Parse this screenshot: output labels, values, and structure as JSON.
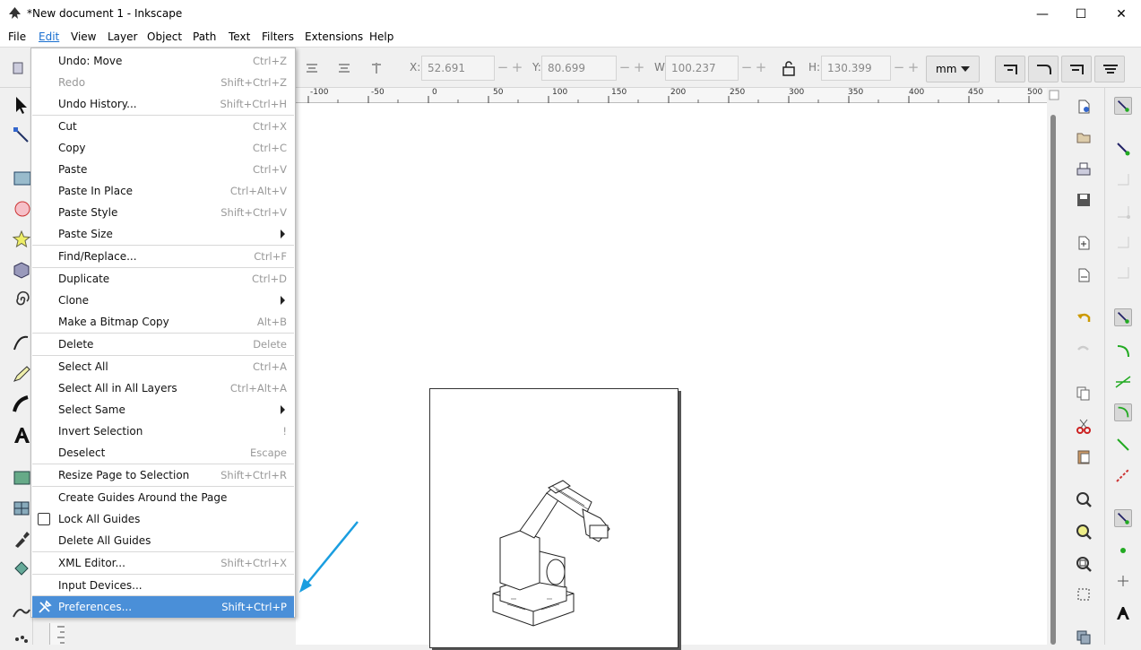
{
  "window": {
    "title": "*New document 1 - Inkscape",
    "minimize": "—",
    "maximize": "☐",
    "close": "✕"
  },
  "menubar": [
    "File",
    "Edit",
    "View",
    "Layer",
    "Object",
    "Path",
    "Text",
    "Filters",
    "Extensions",
    "Help"
  ],
  "toolbar": {
    "x_label": "X:",
    "x_value": "52.691",
    "y_label": "Y:",
    "y_value": "80.699",
    "w_label": "W:",
    "w_value": "100.237",
    "h_label": "H:",
    "h_value": "130.399",
    "minus": "−",
    "plus": "+",
    "unit": "mm"
  },
  "ruler": [
    "-100",
    "-50",
    "0",
    "50",
    "100",
    "150",
    "200",
    "250",
    "300",
    "350",
    "400",
    "450",
    "500"
  ],
  "edit_menu": {
    "undo": {
      "label": "Undo: Move",
      "shortcut": "Ctrl+Z"
    },
    "redo": {
      "label": "Redo",
      "shortcut": "Shift+Ctrl+Z"
    },
    "undo_history": {
      "label": "Undo History...",
      "shortcut": "Shift+Ctrl+H"
    },
    "cut": {
      "label": "Cut",
      "shortcut": "Ctrl+X"
    },
    "copy": {
      "label": "Copy",
      "shortcut": "Ctrl+C"
    },
    "paste": {
      "label": "Paste",
      "shortcut": "Ctrl+V"
    },
    "paste_in_place": {
      "label": "Paste In Place",
      "shortcut": "Ctrl+Alt+V"
    },
    "paste_style": {
      "label": "Paste Style",
      "shortcut": "Shift+Ctrl+V"
    },
    "paste_size": {
      "label": "Paste Size"
    },
    "find_replace": {
      "label": "Find/Replace...",
      "shortcut": "Ctrl+F"
    },
    "duplicate": {
      "label": "Duplicate",
      "shortcut": "Ctrl+D"
    },
    "clone": {
      "label": "Clone"
    },
    "bitmap_copy": {
      "label": "Make a Bitmap Copy",
      "shortcut": "Alt+B"
    },
    "delete": {
      "label": "Delete",
      "shortcut": "Delete"
    },
    "select_all": {
      "label": "Select All",
      "shortcut": "Ctrl+A"
    },
    "select_all_layers": {
      "label": "Select All in All Layers",
      "shortcut": "Ctrl+Alt+A"
    },
    "select_same": {
      "label": "Select Same"
    },
    "invert_selection": {
      "label": "Invert Selection",
      "shortcut": "!"
    },
    "deselect": {
      "label": "Deselect",
      "shortcut": "Escape"
    },
    "resize_page": {
      "label": "Resize Page to Selection",
      "shortcut": "Shift+Ctrl+R"
    },
    "create_guides": {
      "label": "Create Guides Around the Page"
    },
    "lock_guides": {
      "label": "Lock All Guides"
    },
    "delete_guides": {
      "label": "Delete All Guides"
    },
    "xml_editor": {
      "label": "XML Editor...",
      "shortcut": "Shift+Ctrl+X"
    },
    "input_devices": {
      "label": "Input Devices..."
    },
    "preferences": {
      "label": "Preferences...",
      "shortcut": "Shift+Ctrl+P"
    }
  },
  "colors": {
    "highlight": "#4a8fd8",
    "arrow": "#1a9ee0"
  }
}
